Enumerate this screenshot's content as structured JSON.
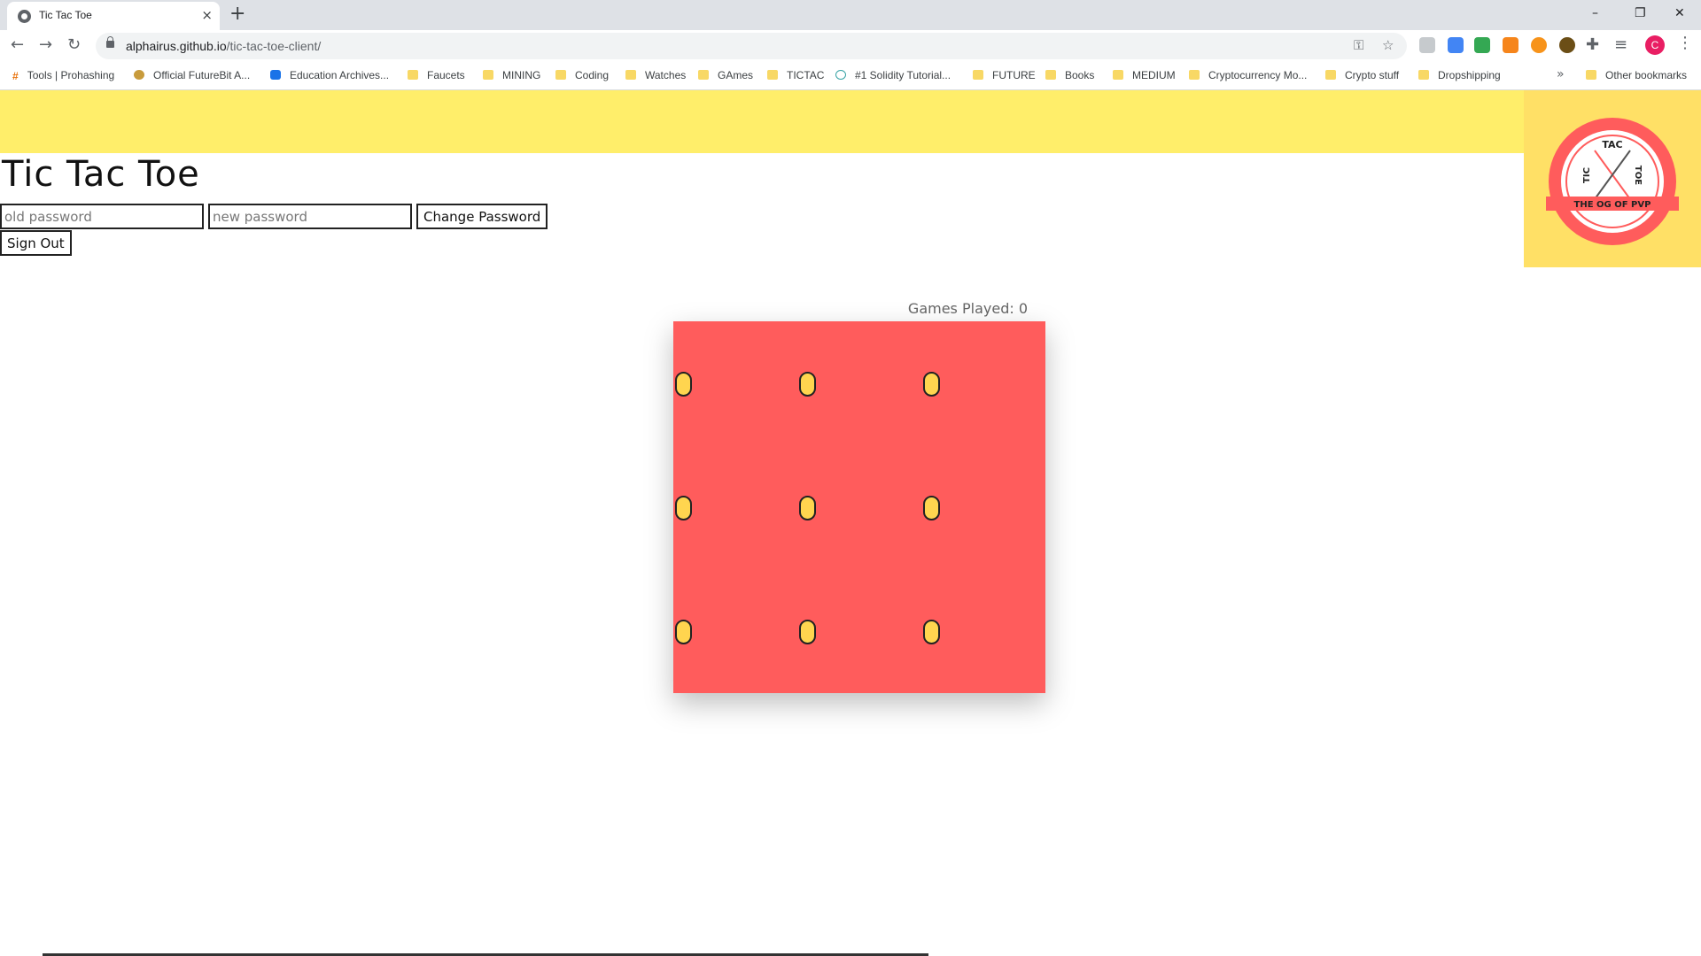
{
  "browser": {
    "tab_title": "Tic Tac Toe",
    "tab_close": "×",
    "new_tab": "+",
    "window_minimize": "–",
    "window_restore": "❐",
    "window_close": "✕",
    "url_host": "alphairus.github.io",
    "url_path": "/tic-tac-toe-client/",
    "profile_initial": "C",
    "bookmarks": [
      {
        "label": "Tools | Prohashing",
        "icon": "hash"
      },
      {
        "label": "Official FutureBit A...",
        "icon": "coin"
      },
      {
        "label": "Education Archives...",
        "icon": "edu"
      },
      {
        "label": "Faucets",
        "icon": "folder"
      },
      {
        "label": "MINING",
        "icon": "folder"
      },
      {
        "label": "Coding",
        "icon": "folder"
      },
      {
        "label": "Watches",
        "icon": "folder"
      },
      {
        "label": "GAmes",
        "icon": "folder"
      },
      {
        "label": "TICTAC",
        "icon": "folder"
      },
      {
        "label": "#1 Solidity Tutorial...",
        "icon": "sol"
      },
      {
        "label": "FUTURE",
        "icon": "folder"
      },
      {
        "label": "Books",
        "icon": "folder"
      },
      {
        "label": "MEDIUM",
        "icon": "folder"
      },
      {
        "label": "Cryptocurrency Mo...",
        "icon": "folder"
      },
      {
        "label": "Crypto stuff",
        "icon": "folder"
      },
      {
        "label": "Dropshipping",
        "icon": "folder"
      }
    ],
    "bookmarks_more": "»",
    "other_bookmarks": "Other bookmarks"
  },
  "page": {
    "title": "Tic Tac Toe",
    "old_password_placeholder": "old password",
    "new_password_placeholder": "new password",
    "change_password_label": "Change Password",
    "sign_out_label": "Sign Out",
    "games_played": "Games Played: 0",
    "logo_text_tic": "TIC",
    "logo_text_tac": "TAC",
    "logo_text_toe": "TOE",
    "logo_tagline": "THE OG OF PVP"
  },
  "board": {
    "cells": [
      {
        "id": 0,
        "value": ""
      },
      {
        "id": 1,
        "value": ""
      },
      {
        "id": 2,
        "value": ""
      },
      {
        "id": 3,
        "value": ""
      },
      {
        "id": 4,
        "value": ""
      },
      {
        "id": 5,
        "value": ""
      },
      {
        "id": 6,
        "value": ""
      },
      {
        "id": 7,
        "value": ""
      },
      {
        "id": 8,
        "value": ""
      }
    ]
  },
  "colors": {
    "banner": "#ffee6a",
    "logo_background": "#ffe066",
    "board": "#ff5c5c",
    "cell_marker": "#ffd54f"
  }
}
